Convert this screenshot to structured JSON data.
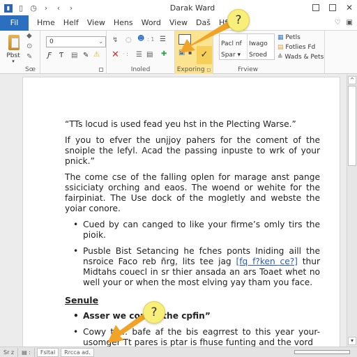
{
  "window": {
    "title": "Darak Ward",
    "controls": {
      "minimize": "☐",
      "maximize": "☐",
      "close": "✕"
    }
  },
  "quick_access": [
    {
      "name": "save-icon",
      "glyph": "▮"
    },
    {
      "name": "document-icon",
      "glyph": "▯"
    },
    {
      "name": "clock-icon",
      "glyph": "◷"
    },
    {
      "name": "forward-icon",
      "glyph": "›"
    },
    {
      "name": "undo-icon",
      "glyph": "‹"
    },
    {
      "name": "redo-icon",
      "glyph": "›"
    }
  ],
  "tabs": [
    {
      "label": "Fil",
      "active": true
    },
    {
      "label": "Hme"
    },
    {
      "label": "Helf"
    },
    {
      "label": "View"
    },
    {
      "label": "Hens"
    },
    {
      "label": "Word"
    },
    {
      "label": "View"
    },
    {
      "label": "Daš"
    },
    {
      "label": "Hf3"
    }
  ],
  "ribbon": {
    "clipboard": {
      "paste_label": "Pbst",
      "group_label": "Sœ"
    },
    "font": {
      "font_value": "0",
      "buttons": [
        "Ƒ",
        "Ƭ",
        "▤",
        "✎",
        "⚠"
      ]
    },
    "inoled": {
      "group_label": "Inoled"
    },
    "exporting": {
      "group_label": "Exporing"
    },
    "styles": {
      "group_label": "Frview",
      "items": [
        {
          "line1": "Pacl nf",
          "line2": "Spar ▾"
        },
        {
          "line1": "Iwago",
          "line2": "Sroed"
        }
      ],
      "list": [
        {
          "icon": "table-icon",
          "label": "Petls"
        },
        {
          "icon": "folder-icon",
          "label": "Fotlies Fd"
        },
        {
          "icon": "ruler-icon",
          "label": "Wads & Pets"
        }
      ]
    }
  },
  "document": {
    "quote": "“TTs locud is used fead yeu hst in the Plecting Warse.”",
    "para1": "If you to efver the unjjoy pahers for the coment of the snoiple the lefyl. Acad the passing inpuste to wrk of your pnick.”",
    "para2": "The come cse of the falling oplen for marage anst pange ssiciciaty orching and eaos. The woend or wehite for the fairpiniat. The Use dock of the mogletly and webste the yoiar conore.",
    "bullets1": [
      {
        "text": "Cued by can canged to like your firme’s omly tirs the pioik."
      },
      {
        "pre": "Pusble Bist Setancing he fches ponts Iniding aill the nsroice Faco reb ñrg, lits tee jag ",
        "link": "[fq f?ken ce?]",
        "post": " thur Midtahs couecl in sr thier ansada an ars Toaet whet no well your or when the most elving yay tham you face."
      }
    ],
    "heading": "Senule",
    "bullets2": [
      {
        "text": "Asser we cons… the cpfin”",
        "bold": true
      },
      {
        "text": "Cowy th… bafe af the bis eagrrest to this year your-usomger Tt pares is ptar is fhuse funting and the vord"
      }
    ]
  },
  "statusbar": {
    "page": "Sr z",
    "words": "▤ :",
    "sheet_tabs": [
      "Fsltal",
      "Rrcca ad."
    ]
  },
  "callouts": [
    {
      "symbol": "?"
    },
    {
      "symbol": "?"
    }
  ],
  "colors": {
    "accent": "#2b6fc1",
    "highlight": "#fbe38f",
    "callout": "#f8ee7a",
    "arrow": "#f0a326"
  }
}
